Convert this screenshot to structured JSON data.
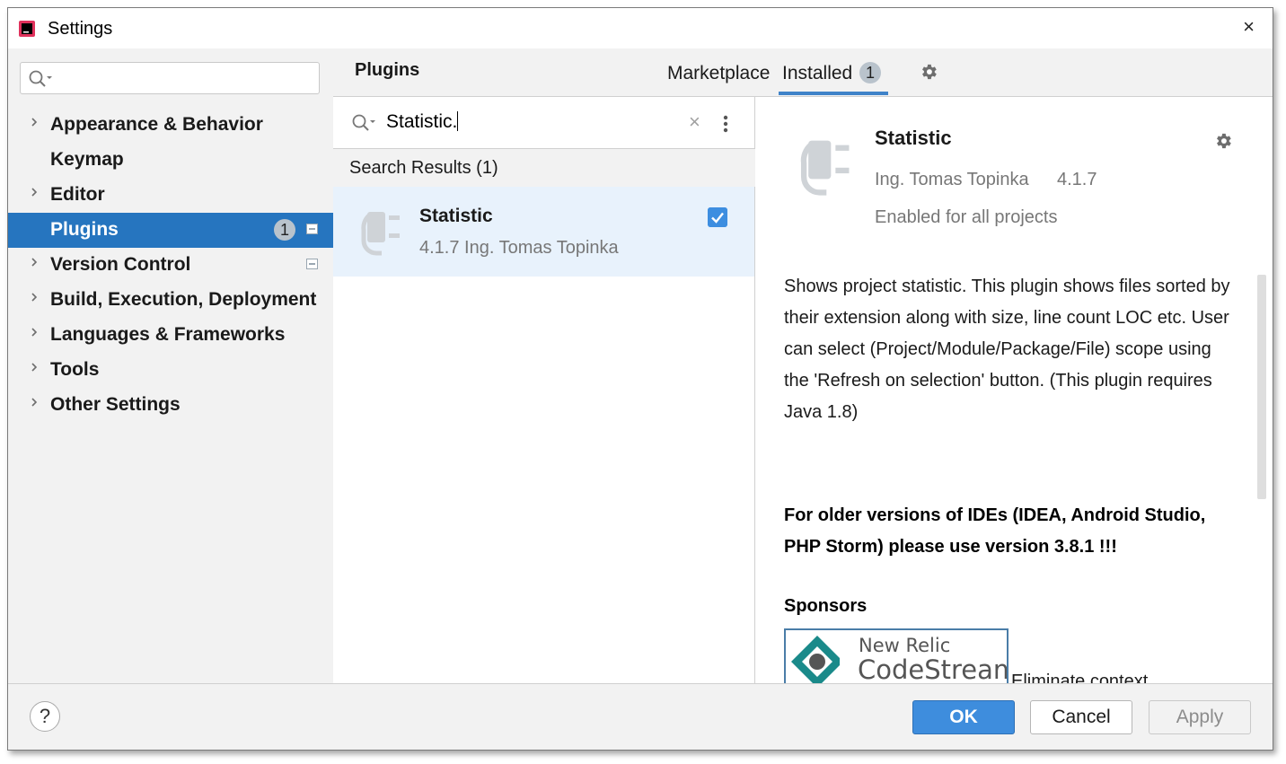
{
  "window": {
    "title": "Settings",
    "close_glyph": "×"
  },
  "sidebar": {
    "search": {
      "value": "",
      "placeholder": ""
    },
    "items": [
      {
        "label": "Appearance & Behavior",
        "expandable": true
      },
      {
        "label": "Keymap",
        "expandable": false
      },
      {
        "label": "Editor",
        "expandable": true
      },
      {
        "label": "Plugins",
        "expandable": false,
        "selected": true,
        "badge": "1"
      },
      {
        "label": "Version Control",
        "expandable": true
      },
      {
        "label": "Build, Execution, Deployment",
        "expandable": true
      },
      {
        "label": "Languages & Frameworks",
        "expandable": true
      },
      {
        "label": "Tools",
        "expandable": true
      },
      {
        "label": "Other Settings",
        "expandable": true
      }
    ]
  },
  "plugins_header": {
    "title": "Plugins",
    "tabs": {
      "marketplace": "Marketplace",
      "installed": "Installed",
      "installed_badge": "1",
      "active": "Installed"
    }
  },
  "plugin_search": {
    "value": "Statistic.",
    "clear_glyph": "×"
  },
  "results": {
    "header": "Search Results (1)",
    "items": [
      {
        "name": "Statistic",
        "meta": "4.1.7  Ing. Tomas Topinka",
        "checked": true
      }
    ]
  },
  "detail": {
    "name": "Statistic",
    "vendor": "Ing. Tomas Topinka",
    "version": "4.1.7",
    "status": "Enabled for all projects",
    "description": "Shows project statistic. This plugin shows files sorted by their extension along with size, line count LOC etc. User can select (Project/Module/Package/File) scope using the 'Refresh on selection' button. (This plugin requires Java 1.8)",
    "warning": "For older versions of IDEs (IDEA, Android Studio, PHP Storm) please use version 3.8.1 !!!",
    "sponsors_heading": "Sponsors",
    "sponsor": {
      "line1": "New Relic",
      "line2": "CodeStream",
      "text": "Eliminate context"
    }
  },
  "footer": {
    "help": "?",
    "ok": "OK",
    "cancel": "Cancel",
    "apply": "Apply"
  },
  "colors": {
    "accent": "#2675bf",
    "ok_button": "#3e8ddd",
    "checkbox": "#3d8ee0",
    "selected_row": "#e8f2fc",
    "sponsor_teal": "#1a8a8a"
  },
  "icons": [
    "app-icon",
    "close-icon",
    "search-icon",
    "chevron-right-icon",
    "project-level-icon",
    "gear-icon",
    "more-vertical-icon",
    "plugin-icon",
    "checkbox-icon",
    "help-icon",
    "codestream-logo"
  ]
}
